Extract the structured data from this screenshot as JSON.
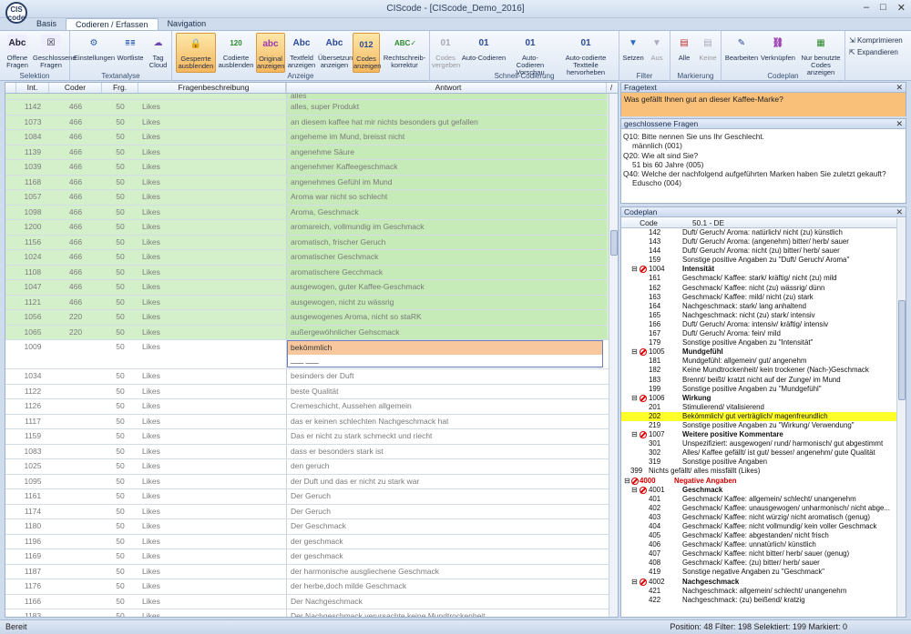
{
  "window": {
    "title": "CIScode - [CIScode_Demo_2016]",
    "logo": "CIS code"
  },
  "tabs": [
    "Basis",
    "Codieren / Erfassen",
    "Navigation"
  ],
  "ribbon": {
    "groups": [
      {
        "label": "Selektion",
        "buttons": [
          "Offene Fragen",
          "Geschlossene Fragen"
        ]
      },
      {
        "label": "Textanalyse",
        "buttons": [
          "Einstellungen",
          "Wortliste",
          "Tag Cloud"
        ]
      },
      {
        "label": "Anzeige",
        "buttons": [
          "Gesperrte ausblenden",
          "Codierte ausblenden",
          "Original anzeigen",
          "Textfeld anzeigen",
          "Übersetzung anzeigen",
          "Codes anzeigen",
          "Rechtschreib-korrektur"
        ]
      },
      {
        "label": "Schnell-Codierung",
        "buttons": [
          "Codes vergeben",
          "Auto-Codieren",
          "Auto-Codieren Vorschau",
          "Auto-codierte Textteile hervorheben"
        ]
      },
      {
        "label": "Filter",
        "buttons": [
          "Setzen",
          "Aus"
        ]
      },
      {
        "label": "Markierung",
        "buttons": [
          "Alle",
          "Keine"
        ]
      },
      {
        "label": "Codeplan",
        "buttons": [
          "Bearbeiten",
          "Verknüpfen",
          "Nur benutzte Codes anzeigen"
        ]
      }
    ],
    "side_buttons": [
      "Komprimieren",
      "Expandieren"
    ]
  },
  "grid": {
    "columns": [
      "Int.",
      "Coder",
      "Frg.",
      "Fragenbeschreibung",
      "Antwort"
    ],
    "first_partial": "alles",
    "rows": [
      [
        "1142",
        "466",
        "50",
        "Likes",
        "alles, super Produkt",
        "g"
      ],
      [
        "1073",
        "466",
        "50",
        "Likes",
        "an diesem kaffee hat mir nichts besonders gut gefallen",
        "g"
      ],
      [
        "1084",
        "466",
        "50",
        "Likes",
        "angeheme im Mund, breisst nicht",
        "g"
      ],
      [
        "1139",
        "466",
        "50",
        "Likes",
        "angenehme Säure",
        "g"
      ],
      [
        "1039",
        "466",
        "50",
        "Likes",
        "angenehmer Kaffeegeschmack",
        "g"
      ],
      [
        "1168",
        "466",
        "50",
        "Likes",
        "angenehmes Gefühl im Mund",
        "g"
      ],
      [
        "1057",
        "466",
        "50",
        "Likes",
        "Aroma war nicht so schlecht",
        "g"
      ],
      [
        "1098",
        "466",
        "50",
        "Likes",
        "Aroma, Geschmack",
        "g"
      ],
      [
        "1200",
        "466",
        "50",
        "Likes",
        "aromareich, vollmundig im  Geschmack",
        "g"
      ],
      [
        "1156",
        "466",
        "50",
        "Likes",
        "aromatisch, frischer Geruch",
        "g"
      ],
      [
        "1024",
        "466",
        "50",
        "Likes",
        "aromatischer Geschmack",
        "g"
      ],
      [
        "1108",
        "466",
        "50",
        "Likes",
        "aromatischere Gecchmack",
        "g"
      ],
      [
        "1047",
        "466",
        "50",
        "Likes",
        "ausgewogen, guter Kaffee-Geschmack",
        "g"
      ],
      [
        "1121",
        "466",
        "50",
        "Likes",
        "ausgewogen, nicht zu wässrig",
        "g"
      ],
      [
        "1056",
        "220",
        "50",
        "Likes",
        "ausgewogenes Aroma, nicht so staRK",
        "g"
      ],
      [
        "1065",
        "220",
        "50",
        "Likes",
        "außergewöhnlicher Gehscmack",
        "g"
      ],
      [
        "1009",
        "",
        "50",
        "Likes",
        "bekömmlich",
        "edit"
      ],
      [
        "1034",
        "",
        "50",
        "Likes",
        "besinders der Duft",
        ""
      ],
      [
        "1122",
        "",
        "50",
        "Likes",
        "beste Qualität",
        ""
      ],
      [
        "1126",
        "",
        "50",
        "Likes",
        "Cremeschicht, Aussehen allgemein",
        ""
      ],
      [
        "1117",
        "",
        "50",
        "Likes",
        "das er keinen schlechten Nachgeschmack hat",
        ""
      ],
      [
        "1159",
        "",
        "50",
        "Likes",
        "Das er nicht zu stark schmeckt und riecht",
        ""
      ],
      [
        "1083",
        "",
        "50",
        "Likes",
        "dass er besonders stark ist",
        ""
      ],
      [
        "1025",
        "",
        "50",
        "Likes",
        "den geruch",
        ""
      ],
      [
        "1095",
        "",
        "50",
        "Likes",
        "der Duft und das er nicht zu stark war",
        ""
      ],
      [
        "1161",
        "",
        "50",
        "Likes",
        "Der Geruch",
        ""
      ],
      [
        "1174",
        "",
        "50",
        "Likes",
        "Der Geruch",
        ""
      ],
      [
        "1180",
        "",
        "50",
        "Likes",
        "Der Geschmack",
        ""
      ],
      [
        "1196",
        "",
        "50",
        "Likes",
        "der geschmack",
        ""
      ],
      [
        "1169",
        "",
        "50",
        "Likes",
        "der geschmack",
        ""
      ],
      [
        "1187",
        "",
        "50",
        "Likes",
        "der harmonische ausgliechene Geschmack",
        ""
      ],
      [
        "1176",
        "",
        "50",
        "Likes",
        "der herbe,doch milde Geschmack",
        ""
      ],
      [
        "1166",
        "",
        "50",
        "Likes",
        "Der Nachgeschmack",
        ""
      ],
      [
        "1183",
        "",
        "50",
        "Likes",
        "Der Nachgeschmack verursachte keine Mundtrockenheit.",
        ""
      ]
    ]
  },
  "fragetext": {
    "title": "Fragetext",
    "text": "Was gefällt Ihnen gut an dieser Kaffee-Marke?"
  },
  "closed_questions": {
    "title": "geschlossene Fragen",
    "lines": [
      "Q10: Bitte nennen Sie uns Ihr Geschlecht.",
      "männlich (001)",
      "Q20: Wie alt sind Sie?",
      "51 bis 60 Jahre (005)",
      "Q40: Welche der nachfolgend aufgeführten Marken haben Sie zuletzt gekauft?",
      "Eduscho (004)"
    ]
  },
  "codeplan": {
    "title": "Codeplan",
    "header": [
      "Code",
      "50.1 - DE"
    ],
    "rows": [
      [
        "142",
        "Duft/ Geruch/ Aroma: natürlich/ nicht (zu) künstlich",
        ""
      ],
      [
        "143",
        "Duft/ Geruch/ Aroma: (angenehm) bitter/ herb/ sauer",
        ""
      ],
      [
        "144",
        "Duft/ Geruch/ Aroma: nicht (zu) bitter/ herb/ sauer",
        ""
      ],
      [
        "159",
        "Sonstige positive Angaben zu \"Duft/ Geruch/ Aroma\"",
        ""
      ],
      [
        "1004",
        "Intensität",
        "grp"
      ],
      [
        "161",
        "Geschmack/ Kaffee: stark/ kräftig/ nicht (zu) mild",
        ""
      ],
      [
        "162",
        "Geschmack/ Kaffee: nicht (zu) wässrig/ dünn",
        ""
      ],
      [
        "163",
        "Geschmack/ Kaffee: mild/ nicht (zu) stark",
        ""
      ],
      [
        "164",
        "Nachgeschmack: stark/ lang anhaltend",
        ""
      ],
      [
        "165",
        "Nachgeschmack: nicht (zu) stark/ intensiv",
        ""
      ],
      [
        "166",
        "Duft/ Geruch/ Aroma: intensiv/ kräftig/ intensiv",
        ""
      ],
      [
        "167",
        "Duft/ Geruch/ Aroma: fein/ mild",
        ""
      ],
      [
        "179",
        "Sonstige positive Angaben zu \"Intensität\"",
        ""
      ],
      [
        "1005",
        "Mundgefühl",
        "grp"
      ],
      [
        "181",
        "Mundgefühl: allgemein/ gut/ angenehm",
        ""
      ],
      [
        "182",
        "Keine Mundtrockenheit/ kein trockener (Nach-)Geschmack",
        ""
      ],
      [
        "183",
        "Brennt/ beißt/ kratzt nicht auf der Zunge/ im Mund",
        ""
      ],
      [
        "199",
        "Sonstige positive Angaben zu \"Mundgefühl\"",
        ""
      ],
      [
        "1006",
        "Wirkung",
        "grp"
      ],
      [
        "201",
        "Stimulierend/ vitalisierend",
        ""
      ],
      [
        "202",
        "Bekömmlich/ gut verträglich/ magenfreundlich",
        "hl"
      ],
      [
        "219",
        "Sonstige positive Angaben zu \"Wirkung/ Verwendung\"",
        ""
      ],
      [
        "1007",
        "Weitere positive Kommentare",
        "grp"
      ],
      [
        "301",
        "Unspezifiziert: ausgewogen/ rund/ harmonisch/ gut abgestimmt",
        ""
      ],
      [
        "302",
        "Alles/ Kaffee gefällt/ ist gut/ besser/ angenehm/ gute Qualität",
        ""
      ],
      [
        "319",
        "Sonstige positive Angaben",
        ""
      ],
      [
        "399",
        "Nichts gefällt/ alles missfällt (Likes)",
        "top"
      ],
      [
        "4000",
        "Negative Angaben",
        "neg"
      ],
      [
        "4001",
        "Geschmack",
        "grp"
      ],
      [
        "401",
        "Geschmack/ Kaffee: allgemein/ schlecht/ unangenehm",
        ""
      ],
      [
        "402",
        "Geschmack/ Kaffee: unausgewogen/ unharmonisch/ nicht abge...",
        ""
      ],
      [
        "403",
        "Geschmack/ Kaffee: nicht würzig/ nicht aromatisch (genug)",
        ""
      ],
      [
        "404",
        "Geschmack/ Kaffee: nicht vollmundig/ kein voller Geschmack",
        ""
      ],
      [
        "405",
        "Geschmack/ Kaffee: abgestanden/ nicht frisch",
        ""
      ],
      [
        "406",
        "Geschmack/ Kaffee: unnatürlich/ künstlich",
        ""
      ],
      [
        "407",
        "Geschmack/ Kaffee: nicht bitter/ herb/ sauer (genug)",
        ""
      ],
      [
        "408",
        "Geschmack/ Kaffee: (zu) bitter/ herb/ sauer",
        ""
      ],
      [
        "419",
        "Sonstige negative Angaben zu \"Geschmack\"",
        ""
      ],
      [
        "4002",
        "Nachgeschmack",
        "grp"
      ],
      [
        "421",
        "Nachgeschmack: allgemein/ schlecht/ unangenehm",
        ""
      ],
      [
        "422",
        "Nachgeschmack: (zu) beißend/ kratzig",
        ""
      ]
    ]
  },
  "status": {
    "left": "Bereit",
    "right": "Position: 48 Filter: 198 Selektiert: 199 Markiert: 0"
  }
}
